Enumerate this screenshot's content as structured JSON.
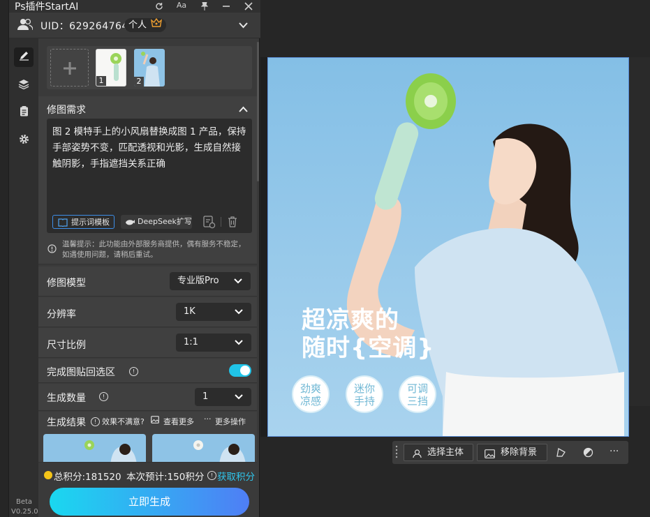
{
  "app": {
    "title": "Ps插件StartAI",
    "beta_label": "Beta",
    "version": "V0.25.0"
  },
  "user": {
    "uid_label": "UID：629264764",
    "account_type": "个人"
  },
  "images": {
    "thumb1_num": "1",
    "thumb2_num": "2"
  },
  "edit_request": {
    "title": "修图需求",
    "prompt_text": "图 2 模特手上的小风扇替换成图 1 产品，保持手部姿势不变，匹配透视和光影，生成自然接触阴影，手指遮挡关系正确",
    "template_button": "提示词模板",
    "deepseek_button": "DeepSeek扩写",
    "notice": "温馨提示：此功能由外部服务商提供，偶有服务不稳定，如遇使用问题，请稍后重试。"
  },
  "settings": {
    "model_label": "修图模型",
    "model_value": "专业版Pro",
    "resolution_label": "分辨率",
    "resolution_value": "1K",
    "ratio_label": "尺寸比例",
    "ratio_value": "1:1",
    "paste_back_label": "完成图贴回选区",
    "count_label": "生成数量",
    "count_value": "1"
  },
  "results": {
    "title": "生成结果",
    "unsatisfied": "效果不满意?",
    "view_more": "查看更多",
    "more_actions": "更多操作"
  },
  "footer": {
    "total_points": "总积分:181520",
    "estimate": "本次预计:150积分",
    "get_points": "获取积分",
    "generate_button": "立即生成"
  },
  "canvas": {
    "headline_1": "超凉爽的",
    "headline_2": "随时{空调}",
    "tag1_l1": "劲爽",
    "tag1_l2": "凉感",
    "tag2_l1": "迷你",
    "tag2_l2": "手持",
    "tag3_l1": "可调",
    "tag3_l2": "三挡"
  },
  "float_toolbar": {
    "select_subject": "选择主体",
    "remove_bg": "移除背景"
  },
  "colors": {
    "accent": "#20c4e8",
    "gen_start": "#1ad8f0",
    "gen_end": "#4f7ef5",
    "link": "#2fc6ec",
    "coin": "#f5c518"
  }
}
